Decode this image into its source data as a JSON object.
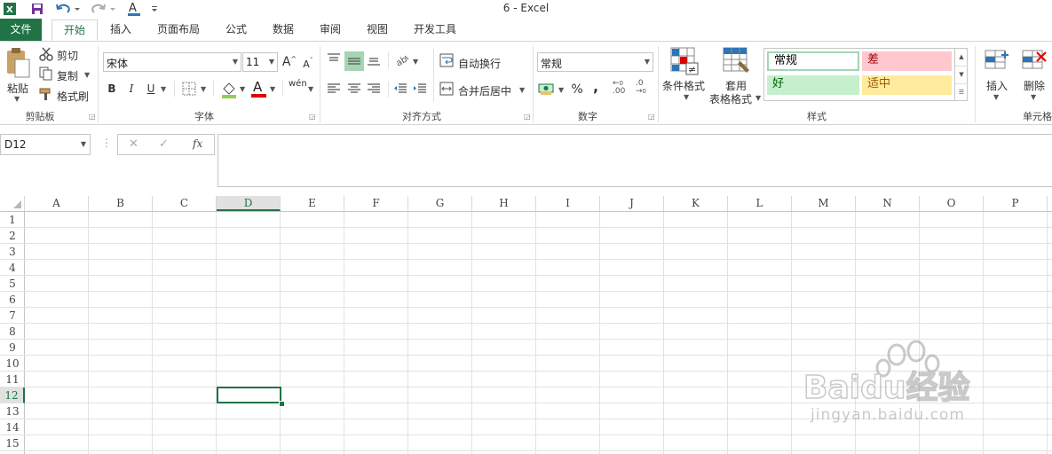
{
  "window": {
    "title": "6 - Excel"
  },
  "quick_access": {
    "excel_icon": "excel-logo-icon",
    "save_icon": "save-icon",
    "undo_icon": "undo-icon",
    "redo_icon": "redo-icon",
    "font_color_icon": "font-color-icon",
    "customize_icon": "customize-icon"
  },
  "tabs": {
    "file": "文件",
    "home": "开始",
    "insert": "插入",
    "page_layout": "页面布局",
    "formulas": "公式",
    "data": "数据",
    "review": "审阅",
    "view": "视图",
    "developer": "开发工具"
  },
  "clipboard": {
    "paste": "粘贴",
    "cut": "剪切",
    "copy": "复制",
    "format_painter": "格式刷",
    "label": "剪贴板"
  },
  "font": {
    "name": "宋体",
    "size": "11",
    "grow": "A",
    "shrink": "A",
    "bold": "B",
    "italic": "I",
    "underline": "U",
    "font_color_letter": "A",
    "phonetic": "wén",
    "label": "字体"
  },
  "alignment": {
    "wrap_text": "自动换行",
    "merge_center": "合并后居中",
    "label": "对齐方式"
  },
  "number": {
    "format": "常规",
    "percent": "%",
    "comma": ",",
    "inc_decimal": ".00",
    "dec_decimal": ".0",
    "label": "数字"
  },
  "styles": {
    "conditional_formatting": "条件格式",
    "format_as_table_1": "套用",
    "format_as_table_2": "表格格式",
    "normal": "常规",
    "bad": "差",
    "good": "好",
    "neutral": "适中",
    "label": "样式"
  },
  "cells": {
    "insert": "插入",
    "delete": "删除",
    "label": "单元格"
  },
  "formula_bar": {
    "name_box": "D12",
    "fx": "fx",
    "cancel": "✕",
    "enter": "✓",
    "formula": ""
  },
  "colors": {
    "excel_green": "#217346",
    "bad_fill": "#ffc7ce",
    "bad_text": "#9c0006",
    "good_fill": "#c6efce",
    "good_text": "#006100",
    "neutral_fill": "#ffeb9c",
    "neutral_text": "#9c5700"
  },
  "grid": {
    "columns": [
      "A",
      "B",
      "C",
      "D",
      "E",
      "F",
      "G",
      "H",
      "I",
      "J",
      "K",
      "L",
      "M",
      "N",
      "O",
      "P"
    ],
    "rows": [
      "1",
      "2",
      "3",
      "4",
      "5",
      "6",
      "7",
      "8",
      "9",
      "10",
      "11",
      "12",
      "13",
      "14",
      "15"
    ],
    "active_cell": "D12"
  },
  "watermark": {
    "brand": "Baidu经验",
    "url": "jingyan.baidu.com"
  }
}
